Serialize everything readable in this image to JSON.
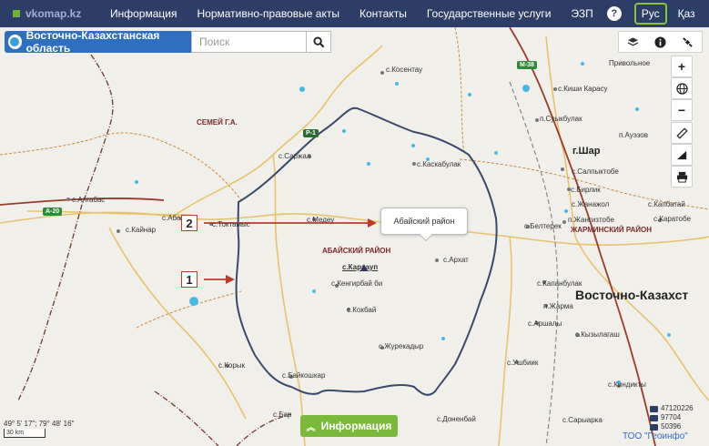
{
  "nav": {
    "logo": "vkomap.kz",
    "items": [
      "Информация",
      "Нормативно-правовые акты",
      "Контакты",
      "Государственные услуги",
      "ЭЗП"
    ],
    "help": "?",
    "lang_ru": "Рус",
    "lang_kz": "Қаз"
  },
  "region": "Восточно-Казахстанская область",
  "search": {
    "placeholder": "Поиск"
  },
  "popup": "Абайский район",
  "callouts": [
    "1",
    "2"
  ],
  "labels": {
    "semey": "СЕМЕЙ Г.А.",
    "kosentau": "с.Коcентау",
    "privolnoe": "Привольное",
    "kishi_karasu": "с.Киши Карасу",
    "suykbulak": "п.Суыкбулак",
    "auezov": "п.Ауэзов",
    "shar": "г.Шар",
    "saryzhal": "с.Саржал",
    "kaskabulak": "с.Каскабулак",
    "salpyktobe": "с.Салпыктобе",
    "birlik": "с.Бирлик",
    "zhanazhol": "с.Жанажол",
    "kapbatay": "с.Капбатай",
    "algabas": "с.Алгабас",
    "abai": "с.Абай",
    "toktamys": "с.Токтамыс",
    "medeu": "с.Медеу",
    "zhangiztobe": "п.Жангизтобе",
    "karatobe": "с.Каратобе",
    "beltereк": "с.Белтерек",
    "kainar": "с.Кайнар",
    "abaiskiy": "АБАЙСКИЙ РАЙОН",
    "zharminsky": "ЖАРМИНСКИЙ РАЙОН",
    "arhat": "с.Архат",
    "karaaul": "с.Караауп",
    "kengirbai": "с.Кенгирбай би",
    "kapanbulak": "с.Капанбулак",
    "vko": "Восточно-Казахст",
    "zharma": "п.Жарма",
    "arshaly": "с.Аршалы",
    "kyzylagash": "с.Кызылагаш",
    "kokbay": "с.Кокбай",
    "zhurekadyr": "с.Журекадыр",
    "ushbiyk": "с.Ушбиик",
    "koryk": "с.Корык",
    "baykoshkar": "с.Байкошкар",
    "kindikty": "с.Киндикты",
    "barshatas": "с.Бар",
    "donenbay": "с.Доненбай",
    "sarybarka": "с.Сарыарка"
  },
  "shields": {
    "m38": "М-38",
    "r1": "Р-1",
    "a20": "А-20"
  },
  "bottom": {
    "coords": "49° 5' 17\"; 79° 48' 16\"",
    "scale": "30 km",
    "info_button": "Информация",
    "stat1": "47120226",
    "stat2": "97704",
    "stat3": "50396",
    "credit": "ТОО \"Геоинфо\""
  },
  "colors": {
    "topbar": "#2c3e66",
    "region_button": "#2e6fbf",
    "info_button": "#7cb93a",
    "boundary": "#3a4a6b",
    "callout_arrow": "#c0392b"
  }
}
